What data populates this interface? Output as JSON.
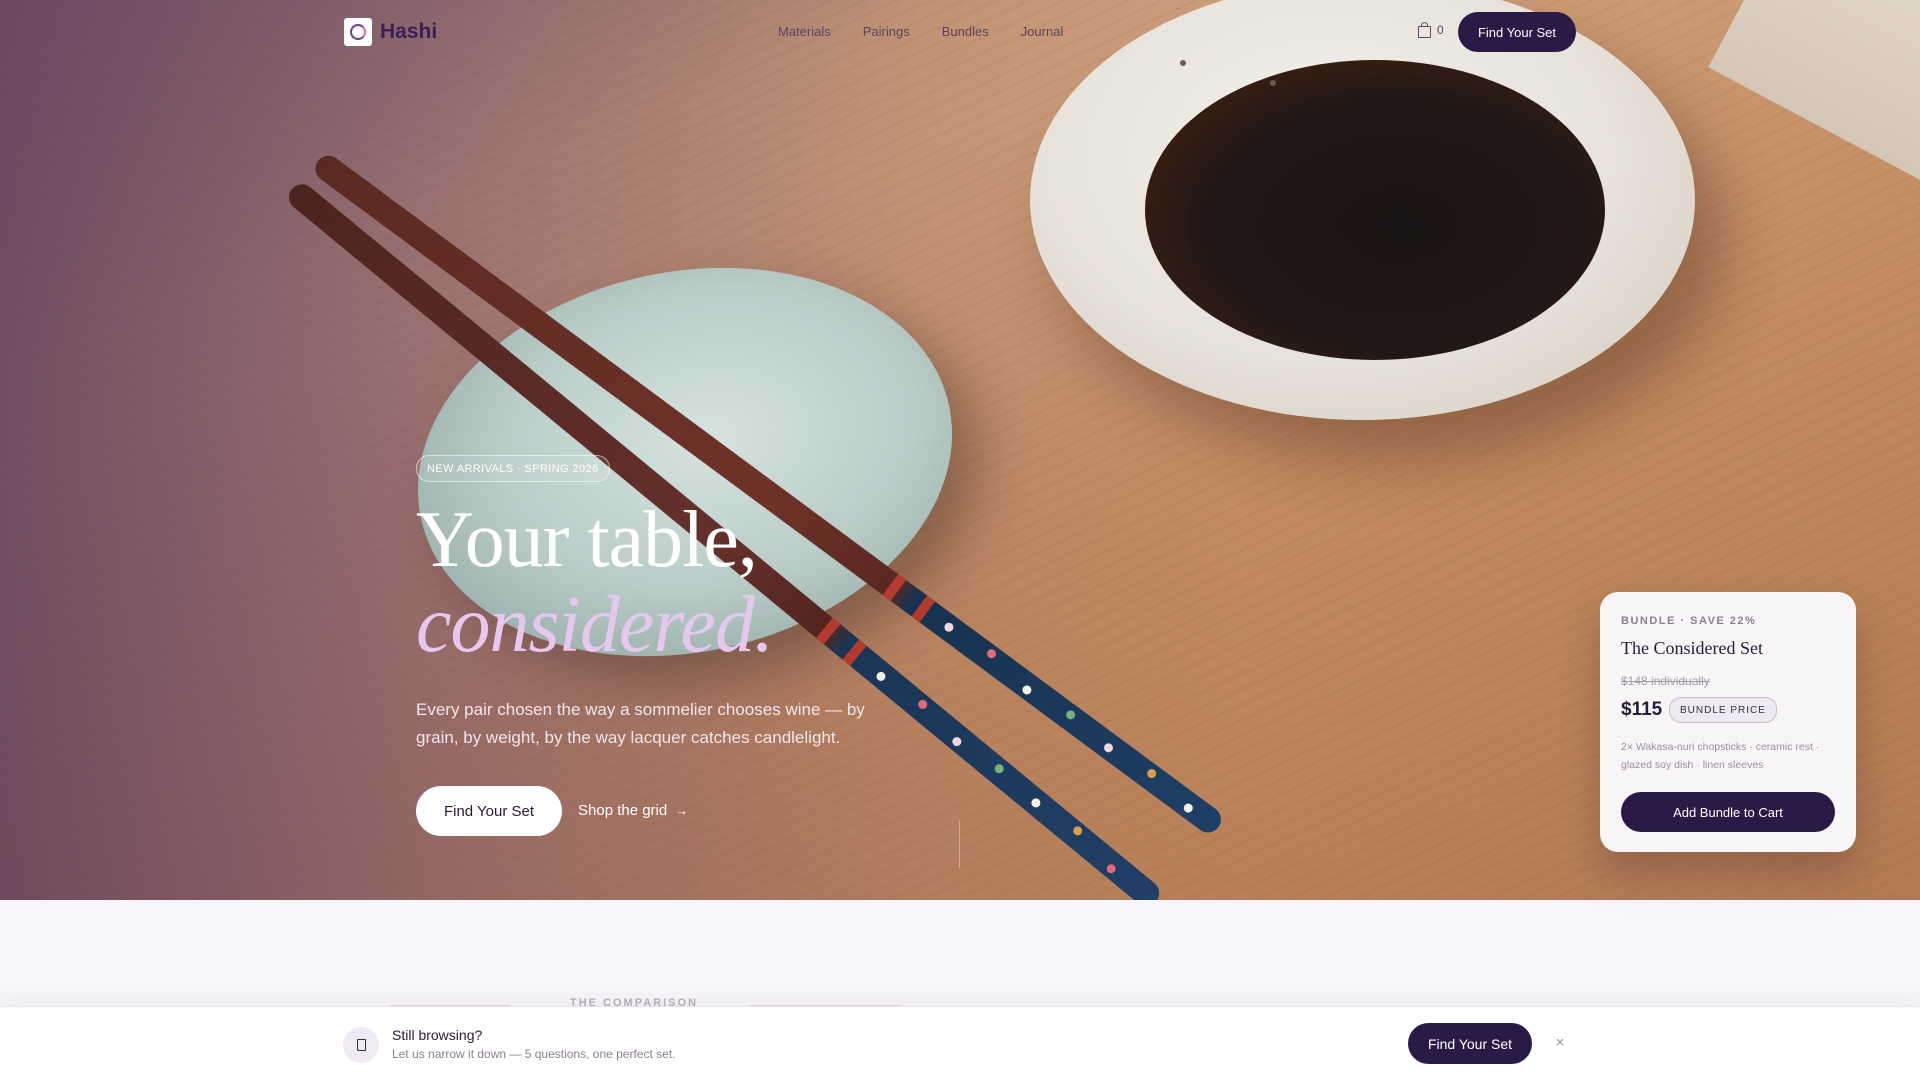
{
  "brand": {
    "name": "Hashi"
  },
  "nav": {
    "links": [
      "Materials",
      "Pairings",
      "Bundles",
      "Journal"
    ],
    "cart_count": "0",
    "cta": "Find Your Set"
  },
  "hero": {
    "pill": "NEW ARRIVALS · SPRING 2026",
    "headline_line1": "Your table,",
    "headline_line2": "considered.",
    "lede": "Every pair chosen the way a sommelier chooses wine — by grain, by weight, by the way lacquer catches candlelight.",
    "cta": "Find Your Set",
    "secondary": "Shop the grid",
    "secondary_arrow": "→"
  },
  "bundle": {
    "eyebrow": "BUNDLE · SAVE 22%",
    "title": "The Considered Set",
    "original": "$148 individually",
    "price": "$115",
    "badge": "BUNDLE PRICE",
    "items": "2× Wakasa-nuri chopsticks · ceramic rest · glazed soy dish · linen sleeves",
    "cta": "Add Bundle to Cart"
  },
  "comparison": {
    "eyebrow": "THE COMPARISON"
  },
  "sticky_bar": {
    "title": "Still browsing?",
    "subtitle": "Let us narrow it down — 5 questions, one perfect set.",
    "cta": "Find Your Set",
    "close": "×"
  },
  "colors": {
    "accent": "#2a1a45",
    "headline_italic": "#e6c8ee",
    "brand": "#3b1f56"
  },
  "icons": {
    "logo": "hashi-logo-icon",
    "cart": "shopping-bag-icon",
    "bar": "chopsticks-icon",
    "close": "close-icon"
  }
}
